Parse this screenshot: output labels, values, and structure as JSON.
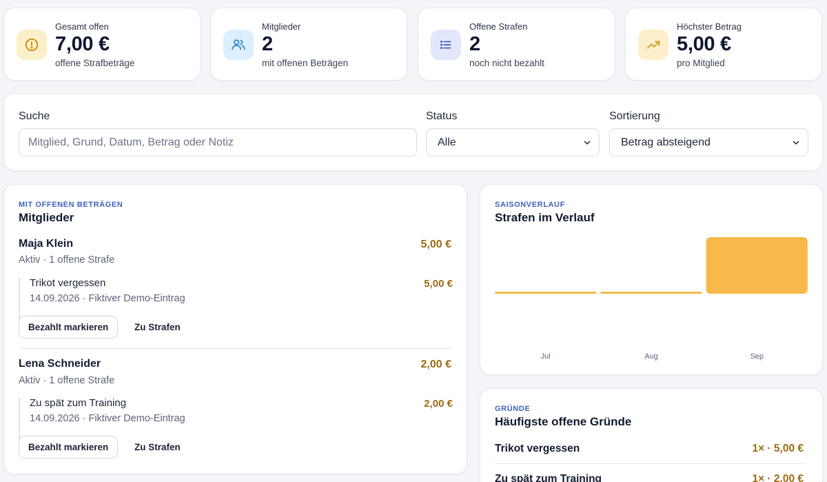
{
  "stats": [
    {
      "label": "Gesamt offen",
      "value": "7,00 €",
      "sub": "offene Strafbeträge",
      "icon": "warning-circle-icon",
      "icon_bg": "#fdefc9",
      "icon_color": "#c58a0a"
    },
    {
      "label": "Mitglieder",
      "value": "2",
      "sub": "mit offenen Beträgen",
      "icon": "users-icon",
      "icon_bg": "#dcefff",
      "icon_color": "#2f7fc8"
    },
    {
      "label": "Offene Strafen",
      "value": "2",
      "sub": "noch nicht bezahlt",
      "icon": "list-icon",
      "icon_bg": "#e2e7fb",
      "icon_color": "#4058b8"
    },
    {
      "label": "Höchster Betrag",
      "value": "5,00 €",
      "sub": "pro Mitglied",
      "icon": "trend-up-icon",
      "icon_bg": "#fdefc9",
      "icon_color": "#d59a1c"
    }
  ],
  "filters": {
    "search_label": "Suche",
    "search_placeholder": "Mitglied, Grund, Datum, Betrag oder Notiz",
    "search_value": "",
    "status_label": "Status",
    "status_value": "Alle",
    "sort_label": "Sortierung",
    "sort_value": "Betrag absteigend"
  },
  "members": {
    "eyebrow": "MIT OFFENEN BETRÄGEN",
    "title": "Mitglieder",
    "items": [
      {
        "name": "Maja Klein",
        "meta": "Aktiv · 1 offene Strafe",
        "total": "5,00 €",
        "penalty_title": "Trikot vergessen",
        "penalty_meta": "14.09.2026 · Fiktiver Demo-Eintrag",
        "penalty_amount": "5,00 €",
        "btn_paid": "Bezahlt markieren",
        "btn_link": "Zu Strafen"
      },
      {
        "name": "Lena Schneider",
        "meta": "Aktiv · 1 offene Strafe",
        "total": "2,00 €",
        "penalty_title": "Zu spät zum Training",
        "penalty_meta": "14.09.2026 · Fiktiver Demo-Eintrag",
        "penalty_amount": "2,00 €",
        "btn_paid": "Bezahlt markieren",
        "btn_link": "Zu Strafen"
      }
    ]
  },
  "season": {
    "eyebrow": "SAISONVERLAUF",
    "title": "Strafen im Verlauf"
  },
  "chart_data": {
    "type": "bar",
    "categories": [
      "Jul",
      "Aug",
      "Sep"
    ],
    "values": [
      0,
      0,
      7
    ],
    "ylim": [
      0,
      7
    ],
    "color": "#f6b94a",
    "title": "Strafen im Verlauf",
    "xlabel": "",
    "ylabel": "",
    "grid": false
  },
  "reasons": {
    "eyebrow": "GRÜNDE",
    "title": "Häufigste offene Gründe",
    "items": [
      {
        "label": "Trikot vergessen",
        "value": "1× · 5,00 €"
      },
      {
        "label": "Zu spät zum Training",
        "value": "1× · 2,00 €"
      }
    ]
  }
}
